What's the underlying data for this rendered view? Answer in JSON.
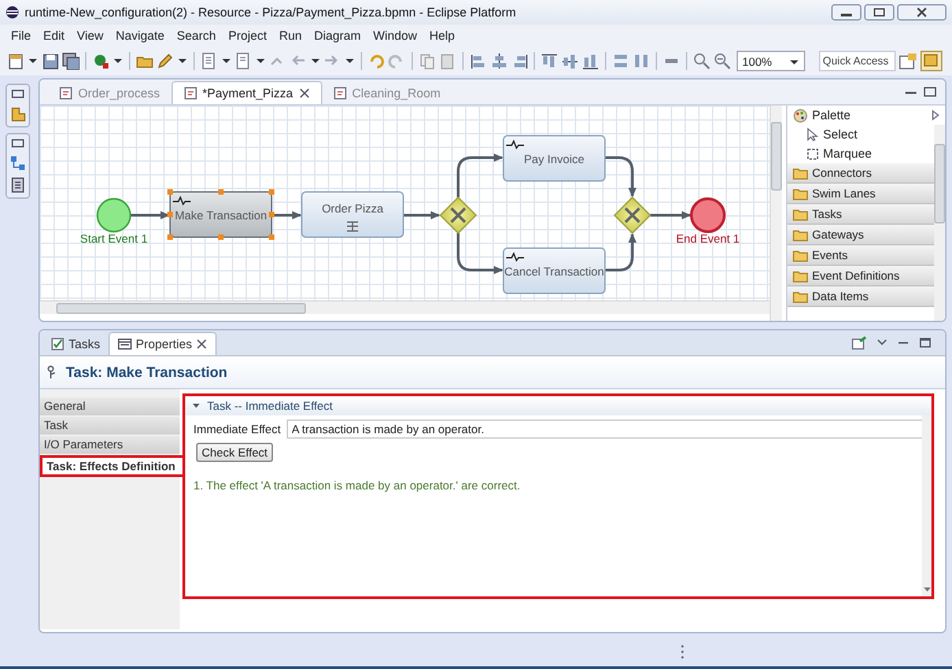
{
  "window": {
    "title": "runtime-New_configuration(2) - Resource - Pizza/Payment_Pizza.bpmn - Eclipse Platform"
  },
  "menu": [
    "File",
    "Edit",
    "View",
    "Navigate",
    "Search",
    "Project",
    "Run",
    "Diagram",
    "Window",
    "Help"
  ],
  "toolbar": {
    "zoom": "100%",
    "quick_access": {
      "placeholder": "Quick Access"
    }
  },
  "editor_tabs": [
    {
      "label": "Order_process",
      "selected": false
    },
    {
      "label": "*Payment_Pizza",
      "selected": true
    },
    {
      "label": "Cleaning_Room",
      "selected": false
    }
  ],
  "diagram": {
    "nodes": [
      {
        "kind": "start_event",
        "label": "Start Event 1",
        "selected": false
      },
      {
        "kind": "task",
        "label": "Make Transaction",
        "script": true,
        "multi_instance": false,
        "selected": true
      },
      {
        "kind": "task",
        "label": "Order Pizza",
        "script": false,
        "multi_instance": true,
        "selected": false
      },
      {
        "kind": "gateway",
        "selected": false
      },
      {
        "kind": "task",
        "label": "Pay Invoice",
        "script": true,
        "multi_instance": false,
        "selected": false
      },
      {
        "kind": "task",
        "label": "Cancel Transaction",
        "script": true,
        "multi_instance": false,
        "selected": false
      },
      {
        "kind": "gateway",
        "selected": false
      },
      {
        "kind": "end_event",
        "label": "End Event 1",
        "selected": false
      }
    ]
  },
  "palette": {
    "title": "Palette",
    "tools": [
      {
        "kind": "select",
        "label": "Select"
      },
      {
        "kind": "marquee",
        "label": "Marquee"
      }
    ],
    "drawers": [
      "Connectors",
      "Swim Lanes",
      "Tasks",
      "Gateways",
      "Events",
      "Event Definitions",
      "Data Items"
    ]
  },
  "properties": {
    "tabs": [
      {
        "label": "Tasks",
        "selected": false
      },
      {
        "label": "Properties",
        "selected": true
      }
    ],
    "title": "Task: Make Transaction",
    "sections": [
      {
        "label": "General",
        "selected": false
      },
      {
        "label": "Task",
        "selected": false
      },
      {
        "label": "I/O Parameters",
        "selected": false
      },
      {
        "label": "Task: Effects Definition",
        "selected": true
      }
    ],
    "section_title": "Task -- Immediate Effect",
    "expanded": true,
    "field": {
      "label": "Immediate Effect",
      "value": "A transaction is made by an operator."
    },
    "button": "Check Effect",
    "result": "1. The effect 'A transaction is made by an operator.' are correct."
  }
}
